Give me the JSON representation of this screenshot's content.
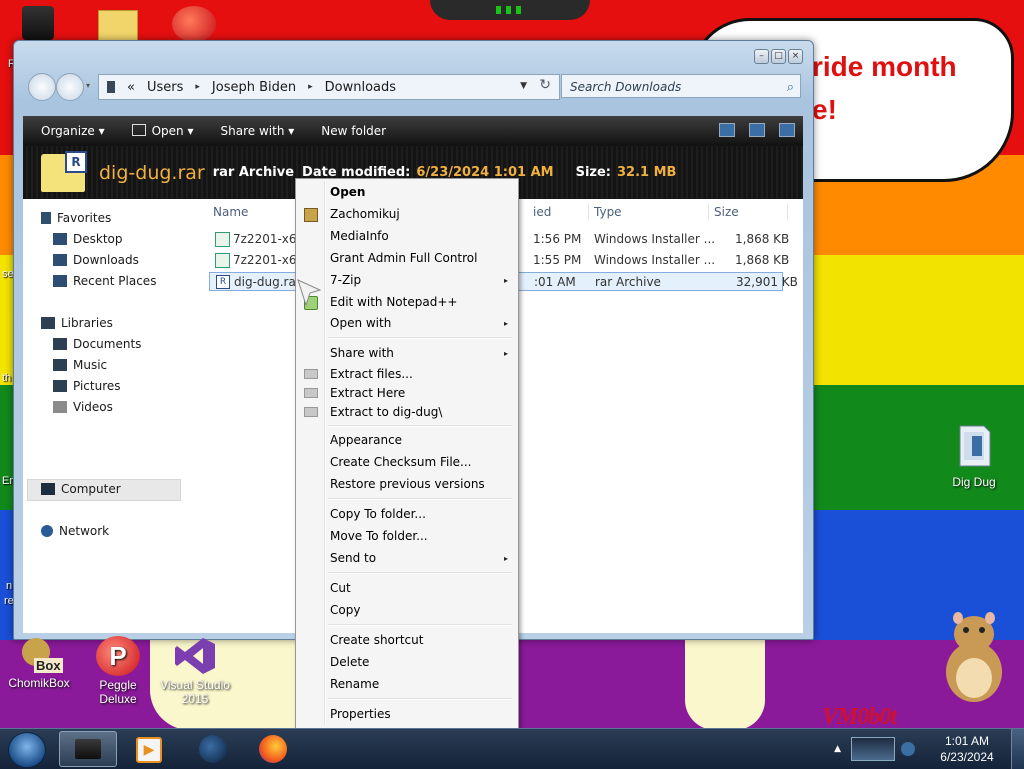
{
  "desktop": {
    "speech_text": "ride month\ne!",
    "edge_texts": [
      "R",
      "se",
      "th",
      "Er",
      "n",
      "re"
    ],
    "icons": [
      {
        "label": "Dig Dug",
        "icon": "folder-document-icon"
      },
      {
        "label": "ChomikBox",
        "icon": "chomikbox-icon"
      },
      {
        "label": "Peggle Deluxe",
        "icon": "peggle-icon"
      },
      {
        "label": "Visual Studio 2015",
        "icon": "visual-studio-icon"
      }
    ],
    "chomik_badge": "Box",
    "vm_logo": "VM0b0t"
  },
  "window": {
    "breadcrumb": [
      "Users",
      "Joseph Biden",
      "Downloads"
    ],
    "breadcrumb_prefix": "«",
    "search_placeholder": "Search Downloads",
    "toolbar": {
      "organize": "Organize",
      "open": "Open",
      "share_with": "Share with",
      "new_folder": "New folder"
    },
    "details": {
      "filename": "dig-dug.rar",
      "type": "rar Archive",
      "date_label": "Date modified:",
      "date_value": "6/23/2024 1:01 AM",
      "size_label": "Size:",
      "size_value": "32.1 MB",
      "icon_letter": "R"
    },
    "nav": {
      "favorites": "Favorites",
      "desktop": "Desktop",
      "downloads": "Downloads",
      "recent_places": "Recent Places",
      "libraries": "Libraries",
      "documents": "Documents",
      "music": "Music",
      "pictures": "Pictures",
      "videos": "Videos",
      "computer": "Computer",
      "network": "Network"
    },
    "columns": {
      "name": "Name",
      "date": "ied",
      "type": "Type",
      "size": "Size"
    },
    "files": [
      {
        "name": "7z2201-x64(1).",
        "date": "1:56 PM",
        "type": "Windows Installer ...",
        "size": "1,868 KB"
      },
      {
        "name": "7z2201-x64.ms",
        "date": "1:55 PM",
        "type": "Windows Installer ...",
        "size": "1,868 KB"
      },
      {
        "name": "dig-dug.rar",
        "date": ":01 AM",
        "type": "rar Archive",
        "size": "32,901 KB"
      }
    ]
  },
  "context_menu": {
    "items": [
      {
        "label": "Open",
        "bold": true
      },
      {
        "label": "Zachomikuj",
        "icon": "chomik-icon"
      },
      {
        "label": "MediaInfo"
      },
      {
        "label": "Grant Admin Full Control"
      },
      {
        "label": "7-Zip",
        "submenu": true
      },
      {
        "label": "Edit with Notepad++",
        "icon": "notepad-plus-icon"
      },
      {
        "label": "Open with",
        "submenu": true
      },
      {
        "label": "Share with",
        "submenu": true
      },
      {
        "label": "Extract files...",
        "icon": "winrar-icon"
      },
      {
        "label": "Extract Here",
        "icon": "winrar-icon"
      },
      {
        "label": "Extract to dig-dug\\",
        "icon": "winrar-icon"
      },
      {
        "label": "Appearance"
      },
      {
        "label": "Create Checksum File..."
      },
      {
        "label": "Restore previous versions"
      },
      {
        "label": "Copy To folder..."
      },
      {
        "label": "Move To folder..."
      },
      {
        "label": "Send to",
        "submenu": true
      },
      {
        "label": "Cut"
      },
      {
        "label": "Copy"
      },
      {
        "label": "Create shortcut"
      },
      {
        "label": "Delete"
      },
      {
        "label": "Rename"
      },
      {
        "label": "Properties"
      }
    ],
    "submenu_arrow": "▸"
  },
  "taskbar": {
    "time": "1:01 AM",
    "date": "6/23/2024",
    "tray_arrow": "▲"
  }
}
